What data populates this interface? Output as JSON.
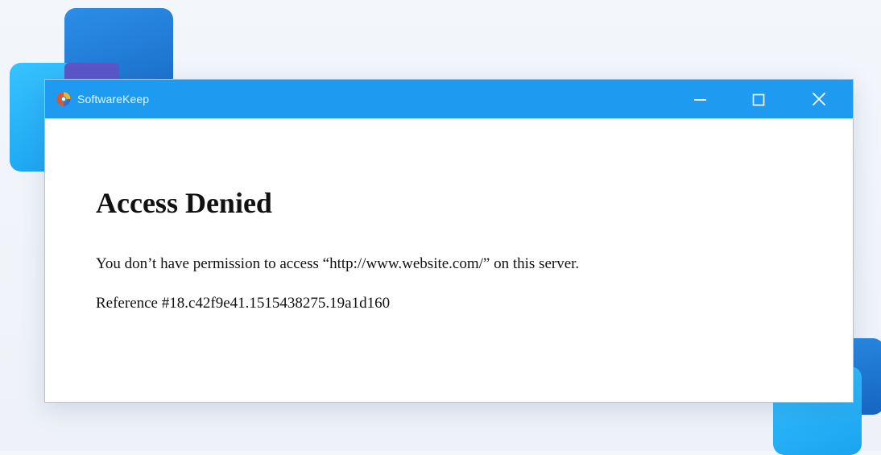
{
  "window": {
    "title": "SoftwareKeep",
    "controls": {
      "minimize_icon": "minimize-icon",
      "maximize_icon": "maximize-icon",
      "close_icon": "close-icon"
    },
    "titlebar_color": "#1e9bf0",
    "app_icon": "browser-logo-icon"
  },
  "page": {
    "heading": "Access Denied",
    "message": "You don’t have permission to access “http://www.website.com/” on this server.",
    "reference": "Reference #18.c42f9e41.1515438275.19a1d160"
  }
}
